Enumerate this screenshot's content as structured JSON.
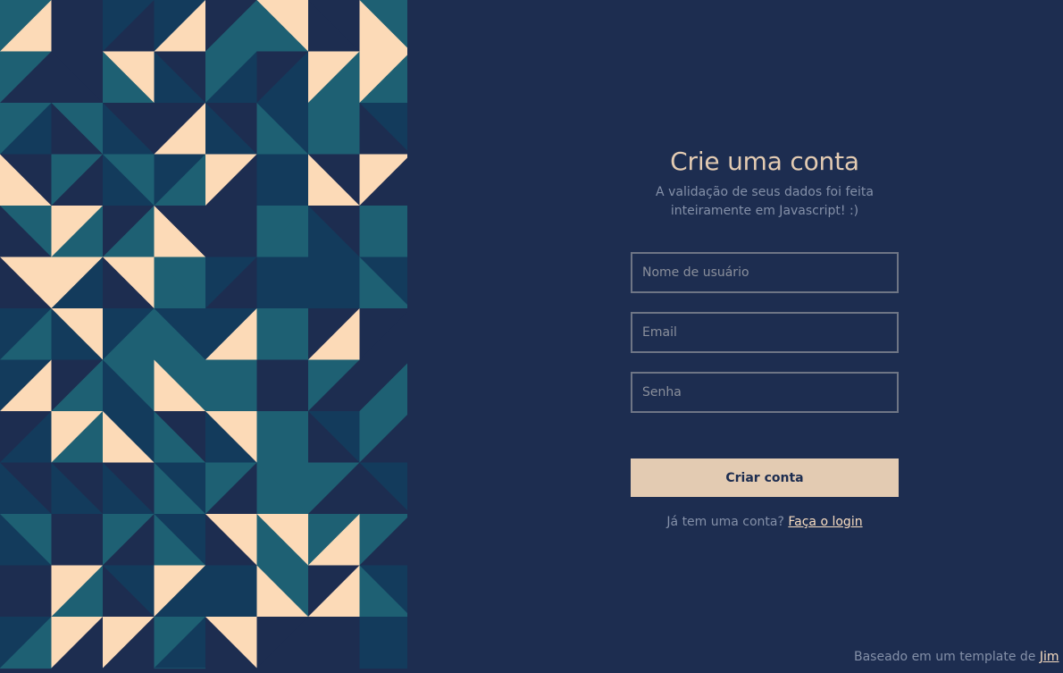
{
  "colors": {
    "background": "#1d2d50",
    "accent": "#e3cbb2",
    "pattern_dark": "#1d2d50",
    "pattern_teal": "#1e6073",
    "pattern_blue": "#133b5c",
    "pattern_cream": "#fcdab7"
  },
  "form": {
    "title": "Crie uma conta",
    "subtitle": "A validação de seus dados foi feita inteiramente em Javascript! :)",
    "fields": {
      "username": {
        "placeholder": "Nome de usuário",
        "value": ""
      },
      "email": {
        "placeholder": "Email",
        "value": ""
      },
      "password": {
        "placeholder": "Senha",
        "value": ""
      }
    },
    "submit_label": "Criar conta",
    "login_prompt": "Já tem uma conta? ",
    "login_link": "Faça o login"
  },
  "footer": {
    "text": "Baseado em um template de ",
    "link": "Jim"
  }
}
